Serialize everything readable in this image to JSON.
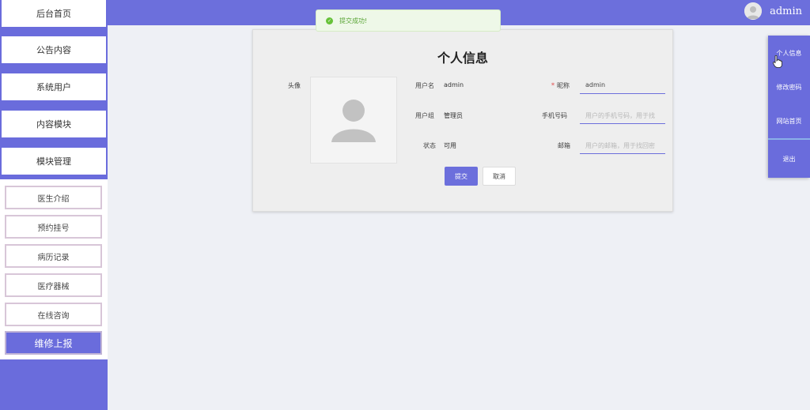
{
  "sidebar": {
    "top_items": [
      {
        "label": "后台首页"
      },
      {
        "label": "公告内容"
      },
      {
        "label": "系统用户"
      },
      {
        "label": "内容模块"
      },
      {
        "label": "模块管理"
      }
    ],
    "sub_items": [
      {
        "label": "医生介绍"
      },
      {
        "label": "预约挂号"
      },
      {
        "label": "病历记录"
      },
      {
        "label": "医疗器械"
      },
      {
        "label": "在线咨询"
      },
      {
        "label": "维修上报"
      }
    ]
  },
  "header": {
    "username": "admin",
    "avatar_icon": "user-avatar-icon"
  },
  "toast": {
    "message": "提交成功!",
    "icon": "check-circle-icon",
    "color": "#67c23a"
  },
  "profile": {
    "title": "个人信息",
    "avatar_label": "头像",
    "username_label": "用户名",
    "username_value": "admin",
    "group_label": "用户组",
    "group_value": "管理员",
    "status_label": "状态",
    "status_value": "可用",
    "nickname_label": "昵称",
    "nickname_required": "*",
    "nickname_value": "admin",
    "phone_label": "手机号码",
    "phone_placeholder": "用户的手机号码，用于找",
    "email_label": "邮箱",
    "email_placeholder": "用户的邮箱，用于找回密",
    "submit_label": "提交",
    "cancel_label": "取消"
  },
  "dropdown": {
    "items": [
      {
        "label": "个人信息"
      },
      {
        "label": "修改密码"
      },
      {
        "label": "网站首页"
      },
      {
        "label": "退出"
      }
    ]
  },
  "colors": {
    "accent": "#6a6cdc",
    "sub_border": "#d8c6d8"
  }
}
